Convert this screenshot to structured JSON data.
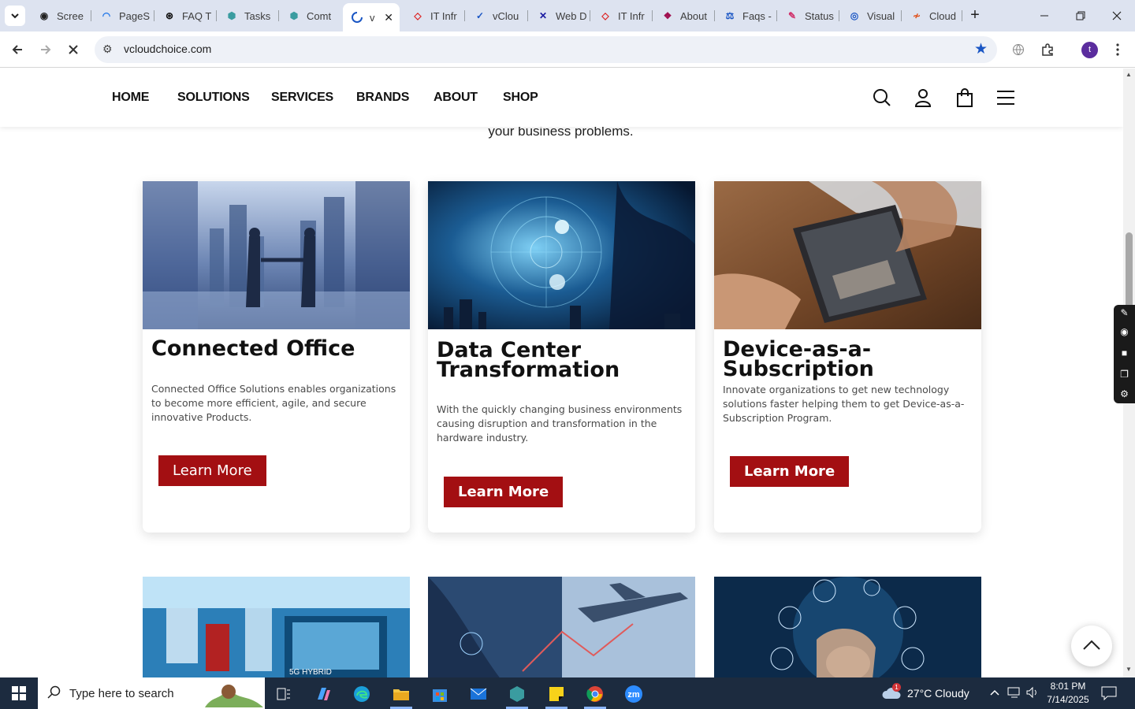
{
  "browser": {
    "tabs": [
      {
        "title": "Scree",
        "icon": "screencast-icon"
      },
      {
        "title": "PageS",
        "icon": "pagespeed-icon"
      },
      {
        "title": "FAQ T",
        "icon": "faq-icon"
      },
      {
        "title": "Tasks",
        "icon": "tasks-icon"
      },
      {
        "title": "Comt",
        "icon": "comt-icon"
      },
      {
        "title": "v",
        "icon": "loading-icon",
        "active": true
      },
      {
        "title": "IT Infr",
        "icon": "it-infra-icon"
      },
      {
        "title": "vClou",
        "icon": "vcloud-icon"
      },
      {
        "title": "Web D",
        "icon": "webd-icon"
      },
      {
        "title": "IT Infr",
        "icon": "it-infra-icon"
      },
      {
        "title": "About",
        "icon": "about-icon"
      },
      {
        "title": "Faqs -",
        "icon": "faqs-icon"
      },
      {
        "title": "Status",
        "icon": "status-icon"
      },
      {
        "title": "Visual",
        "icon": "visual-icon"
      },
      {
        "title": "Cloud",
        "icon": "cloud-icon"
      }
    ],
    "url": "vcloudchoice.com",
    "profile_initial": "t"
  },
  "site": {
    "nav": [
      "HOME",
      "SOLUTIONS",
      "SERVICES",
      "BRANDS",
      "ABOUT",
      "SHOP"
    ],
    "intro_tail": "your business problems.",
    "cards": [
      {
        "title": "Connected Office",
        "text": "Connected Office Solutions enables organizations to become more efficient, agile, and secure innovative Products.",
        "button": "Learn More"
      },
      {
        "title": "Data Center Transformation",
        "text": "With the quickly changing business environments causing disruption and transformation in the hardware industry.",
        "button": "Learn More"
      },
      {
        "title": "Device-as-a-Subscription",
        "text": "Innovate organizations to get new technology solutions faster helping them to get Device-as-a-Subscription Program.",
        "button": "Learn More"
      }
    ],
    "second_row_image_text": "5G HYBRID"
  },
  "taskbar": {
    "search_placeholder": "Type here to search",
    "weather": "27°C  Cloudy",
    "weather_badge": "1",
    "time": "8:01 PM",
    "date": "7/14/2025",
    "zoom_label": "zm"
  },
  "colors": {
    "brand_red": "#a30f12",
    "tabstrip": "#dde3f0",
    "taskbar": "#1c2b3f"
  }
}
